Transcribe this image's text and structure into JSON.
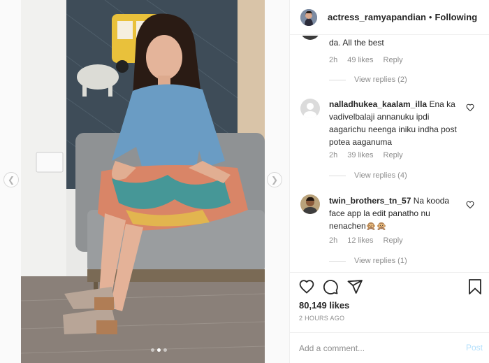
{
  "header": {
    "username": "actress_ramyapandian",
    "separator": "•",
    "follow_label": "Following"
  },
  "media": {
    "prev_icon": "chevron-left-icon",
    "next_icon": "chevron-right-icon",
    "slide_count": 3,
    "active_slide": 2
  },
  "comments": {
    "partial_top": {
      "text": "da. All the best",
      "time": "2h",
      "likes": "49 likes",
      "reply": "Reply",
      "view_replies": "View replies (2)"
    },
    "items": [
      {
        "username": "nalladhukea_kaalam_illa",
        "text": "Ena ka vadivelbalaji annanuku ipdi aagarichu neenga iniku indha post potea aaganuma",
        "time": "2h",
        "likes": "39 likes",
        "reply": "Reply",
        "view_replies": "View replies (4)"
      },
      {
        "username": "twin_brothers_tn_57",
        "text": "Na kooda face app la edit panatho nu nenachen🙊🙊",
        "time": "2h",
        "likes": "12 likes",
        "reply": "Reply",
        "view_replies": "View replies (1)"
      }
    ]
  },
  "actions": {
    "like_icon": "heart-icon",
    "comment_icon": "comment-icon",
    "share_icon": "paper-plane-icon",
    "save_icon": "bookmark-icon",
    "likes_count": "80,149 likes",
    "timestamp": "2 HOURS AGO"
  },
  "add_comment": {
    "placeholder": "Add a comment...",
    "post_label": "Post"
  },
  "colors": {
    "muted": "#8e8e8e",
    "post_disabled": "#b2dffc",
    "border": "#efefef"
  }
}
